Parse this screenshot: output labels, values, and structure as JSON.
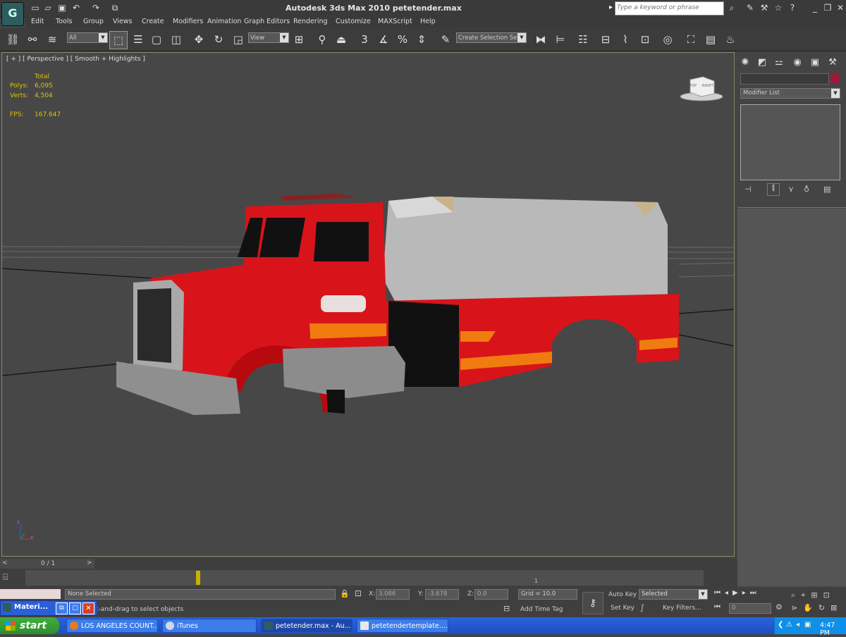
{
  "window": {
    "title": "Autodesk 3ds Max  2010      petetender.max"
  },
  "search": {
    "placeholder": "Type a keyword or phrase"
  },
  "menu": [
    "Edit",
    "Tools",
    "Group",
    "Views",
    "Create",
    "Modifiers",
    "Animation",
    "Graph Editors",
    "Rendering",
    "Customize",
    "MAXScript",
    "Help"
  ],
  "toolbar": {
    "selection_filter": "All",
    "ref_coord": "View",
    "named_selection": "Create Selection Se"
  },
  "viewport": {
    "label": "[ + ] [ Perspective ] [ Smooth + Highlights ]",
    "stats": {
      "total_label": "Total",
      "polys_label": "Polys:",
      "polys": "6,095",
      "verts_label": "Verts:",
      "verts": "4,504",
      "fps_label": "FPS:",
      "fps": "167.647"
    },
    "viewcube": {
      "top": "TOP",
      "right": "RIGHT"
    },
    "axis": {
      "z": "z",
      "x": "x"
    }
  },
  "command_panel": {
    "modifier_list": "Modifier List"
  },
  "timeline": {
    "frame": "0 / 1",
    "track_tick": "1"
  },
  "status": {
    "selection": "None Selected",
    "prompt": "Click-and-drag to select objects",
    "x_label": "X:",
    "x": "3.086",
    "y_label": "Y:",
    "y": "-3.678",
    "z_label": "Z:",
    "z": "0.0",
    "grid": "Grid = 10.0",
    "auto_key": "Auto Key",
    "set_key": "Set Key",
    "key_mode": "Selected",
    "key_filters": "Key Filters...",
    "add_time_tag": "Add Time Tag",
    "current_frame": "0"
  },
  "mini_window": {
    "label": "Materi..."
  },
  "taskbar": {
    "start": "start",
    "tasks": [
      "LOS ANGELES COUNT...",
      "iTunes",
      "petetender.max - Au...",
      "petetendertemplate...."
    ],
    "clock": "4:47 PM"
  },
  "colors": {
    "accent_yellow": "#e0c200",
    "truck_red": "#d8141a",
    "tank_gray": "#b9b9b9",
    "taskbar_blue": "#245ad3"
  }
}
